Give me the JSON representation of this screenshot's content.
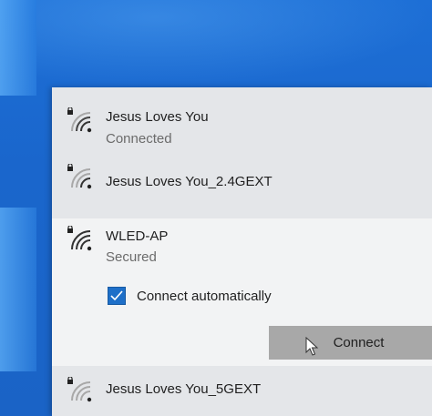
{
  "networks": [
    {
      "ssid": "Jesus Loves You",
      "status": "Connected",
      "secured_lock": true,
      "icon": "wifi-lock-icon"
    },
    {
      "ssid": "Jesus Loves You_2.4GEXT",
      "secured_lock": true,
      "icon": "wifi-lock-icon"
    },
    {
      "ssid": "WLED-AP",
      "status": "Secured",
      "secured_lock": true,
      "icon": "wifi-lock-icon",
      "expanded": true,
      "auto_connect": {
        "label": "Connect automatically",
        "checked": true
      },
      "connect_label": "Connect"
    },
    {
      "ssid": "Jesus Loves You_5GEXT",
      "secured_lock": true,
      "icon": "wifi-lock-icon"
    }
  ],
  "colors": {
    "desktop_blue": "#1a66cc",
    "flyout_bg": "#e4e6e9",
    "expanded_bg": "#f2f3f4",
    "checkbox_accent": "#1e6fc8",
    "connect_button": "#a8a8a8"
  }
}
